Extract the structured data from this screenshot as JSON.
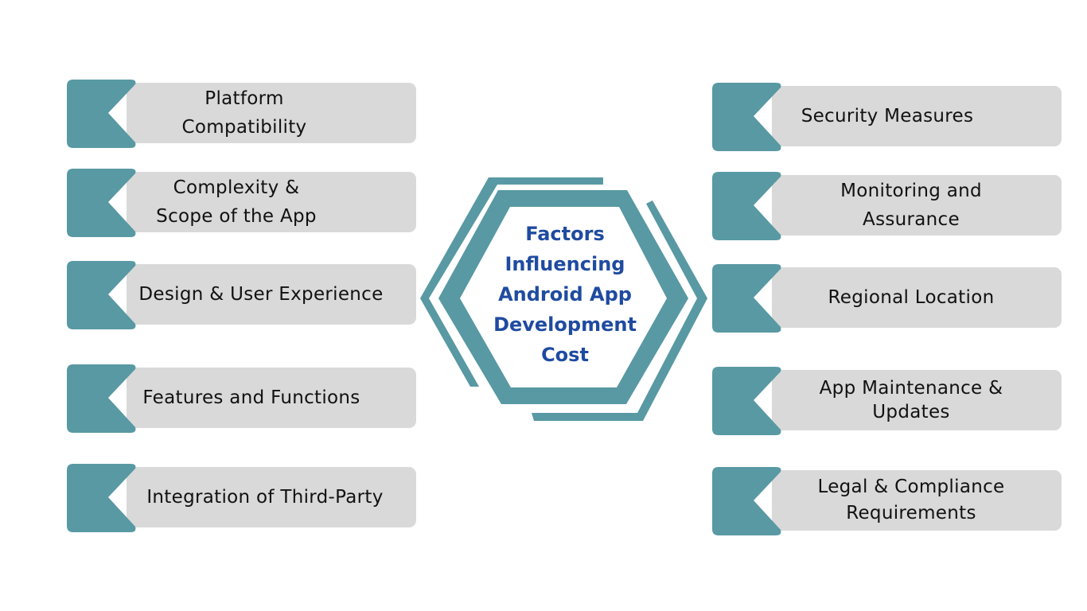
{
  "title": "Factors\nInfluencing\nAndroid App\nDevelopment\nCost",
  "colors": {
    "accent_teal": "#5899a3",
    "bar_gray": "#d9d9d9",
    "title_blue": "#1f4ba0",
    "text_dark": "#111111"
  },
  "left_factors": [
    {
      "label": "Platform\nCompatibility"
    },
    {
      "label": "Complexity &\nScope of the App"
    },
    {
      "label": "Design & User Experience"
    },
    {
      "label": "Features and Functions"
    },
    {
      "label": "Integration of Third-Party"
    }
  ],
  "right_factors": [
    {
      "label": "Security Measures"
    },
    {
      "label": "Monitoring and\nAssurance"
    },
    {
      "label": "Regional Location"
    },
    {
      "label": "App Maintenance &\nUpdates"
    },
    {
      "label": "Legal & Compliance\nRequirements"
    }
  ]
}
